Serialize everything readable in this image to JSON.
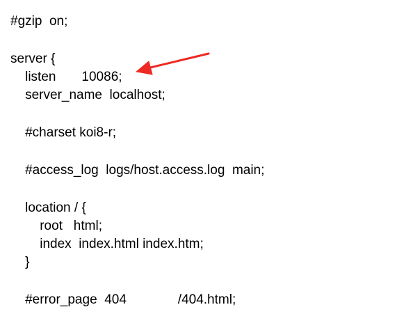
{
  "lines": [
    "#gzip  on;",
    "",
    "server {",
    "    listen       10086;",
    "    server_name  localhost;",
    "",
    "    #charset koi8-r;",
    "",
    "    #access_log  logs/host.access.log  main;",
    "",
    "    location / {",
    "        root   html;",
    "        index  index.html index.htm;",
    "    }",
    "",
    "    #error_page  404              /404.html;"
  ],
  "annotation": {
    "icon": "arrow-icon",
    "color": "#ee2a24"
  }
}
